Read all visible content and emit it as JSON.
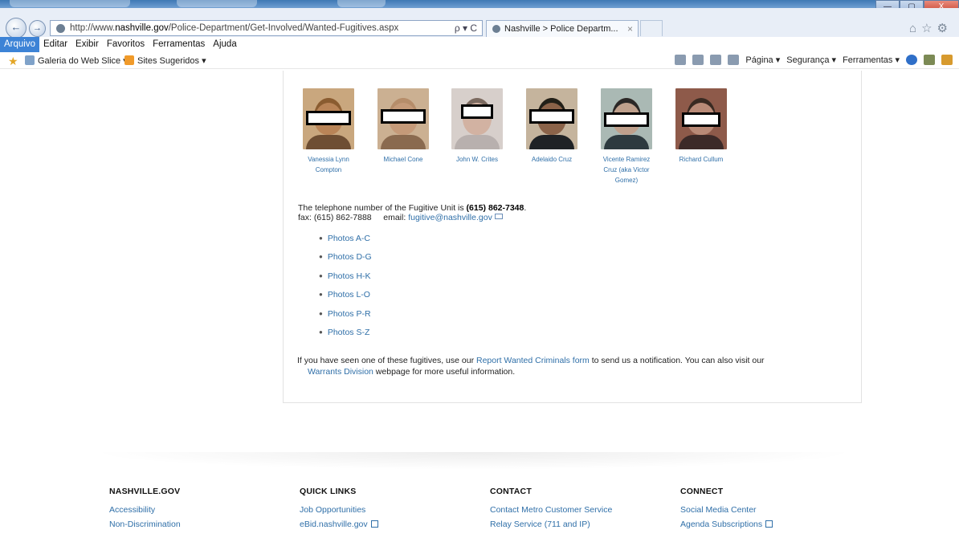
{
  "browser": {
    "url_prefix": "http://www.",
    "url_domain": "nashville.gov",
    "url_path": "/Police-Department/Get-Involved/Wanted-Fugitives.aspx",
    "address_controls": "ρ ▾ C",
    "tab_title": "Nashville > Police Departm...",
    "tab_close": "×",
    "window_buttons": [
      "—",
      "▢",
      "X"
    ]
  },
  "menu": [
    "Arquivo",
    "Editar",
    "Exibir",
    "Favoritos",
    "Ferramentas",
    "Ajuda"
  ],
  "favorites": {
    "web_slice": "Galeria do Web Slice ▾",
    "suggested": "Sites Sugeridos ▾"
  },
  "command_bar": {
    "page": "Página ▾",
    "security": "Segurança ▾",
    "tools": "Ferramentas ▾"
  },
  "fugitives": [
    {
      "name_line1": "Vanessia Lynn",
      "name_line2": "Compton",
      "name_line3": "",
      "skin": "#b98457",
      "hair": "#8a5c30",
      "bg": "#c9a77e",
      "shirt": "#6e4e33"
    },
    {
      "name_line1": "Michael Cone",
      "name_line2": "",
      "name_line3": "",
      "skin": "#c59a79",
      "hair": "#b68d6a",
      "bg": "#cbb092",
      "shirt": "#8a6a4f"
    },
    {
      "name_line1": "John W. Crites",
      "name_line2": "",
      "name_line3": "",
      "skin": "#d2b2a2",
      "hair": "#7b6a60",
      "bg": "#d7cfcb",
      "shirt": "#b8b0ae"
    },
    {
      "name_line1": "Adelaido Cruz",
      "name_line2": "",
      "name_line3": "",
      "skin": "#8b6349",
      "hair": "#222018",
      "bg": "#c5b49d",
      "shirt": "#1f2225"
    },
    {
      "name_line1": "Vicente Ramirez",
      "name_line2": "Cruz (aka Victor",
      "name_line3": "Gomez)",
      "skin": "#bfa08c",
      "hair": "#2b2827",
      "bg": "#aab9b4",
      "shirt": "#2d3a3f"
    },
    {
      "name_line1": "Richard Cullum",
      "name_line2": "",
      "name_line3": "",
      "skin": "#b98a77",
      "hair": "#3a2a22",
      "bg": "#8e5a4a",
      "shirt": "#3c2a28"
    }
  ],
  "contact": {
    "phone_prefix": "The telephone number of the Fugitive Unit is ",
    "phone": "(615) 862-7348",
    "phone_suffix": ".",
    "fax": "fax: (615) 862-7888",
    "email_label": "email:",
    "email": "fugitive@nashville.gov"
  },
  "photo_links": [
    "Photos A-C",
    "Photos D-G",
    "Photos H-K",
    "Photos L-O",
    "Photos P-R",
    "Photos S-Z"
  ],
  "report": {
    "text1": "If you have seen one of these fugitives, use our ",
    "link1": "Report Wanted Criminals form",
    "text2": " to send us a notification. You can also visit our",
    "link2": "Warrants Division",
    "text3": " webpage for more useful information."
  },
  "footer": [
    {
      "heading": "NASHVILLE.GOV",
      "links": [
        "Accessibility",
        "Non-Discrimination"
      ],
      "external": [
        false,
        false
      ]
    },
    {
      "heading": "QUICK LINKS",
      "links": [
        "Job Opportunities",
        "eBid.nashville.gov"
      ],
      "external": [
        false,
        true
      ]
    },
    {
      "heading": "CONTACT",
      "links": [
        "Contact Metro Customer Service",
        "Relay Service (711 and IP)"
      ],
      "external": [
        false,
        false
      ]
    },
    {
      "heading": "CONNECT",
      "links": [
        "Social Media Center",
        "Agenda Subscriptions"
      ],
      "external": [
        false,
        true
      ]
    }
  ]
}
